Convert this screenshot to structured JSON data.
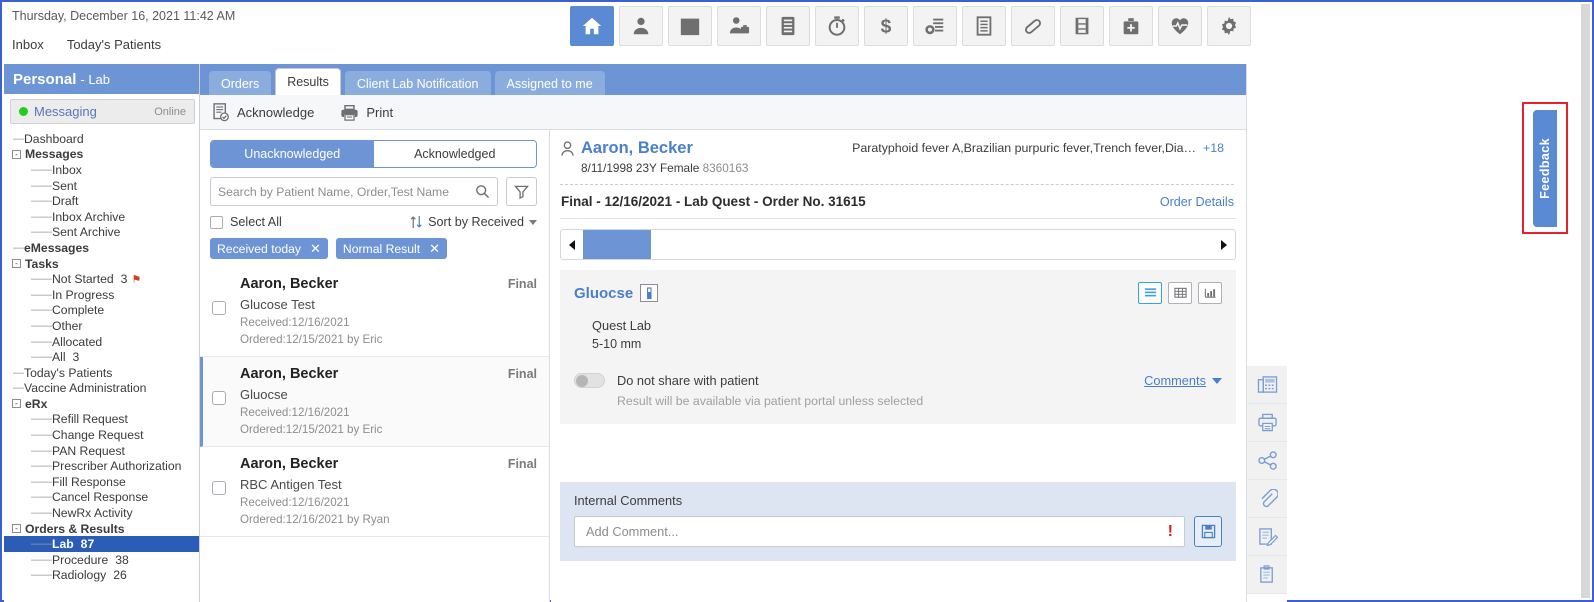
{
  "topbar": {
    "datetime": "Thursday, December 16, 2021  11:42 AM",
    "nav": [
      {
        "label": "Inbox"
      },
      {
        "label": "Today's Patients"
      }
    ],
    "icons": [
      {
        "name": "home-icon",
        "active": true
      },
      {
        "name": "patient-icon",
        "active": false
      },
      {
        "name": "calendar-icon",
        "active": false
      },
      {
        "name": "provider-icon",
        "active": false
      },
      {
        "name": "chart-file-icon",
        "active": false
      },
      {
        "name": "timer-icon",
        "active": false
      },
      {
        "name": "dollar-icon",
        "active": false
      },
      {
        "name": "billing-icon",
        "active": false
      },
      {
        "name": "document-icon",
        "active": false
      },
      {
        "name": "pill-icon",
        "active": false
      },
      {
        "name": "film-icon",
        "active": false
      },
      {
        "name": "medkit-icon",
        "active": false
      },
      {
        "name": "vitals-icon",
        "active": false
      },
      {
        "name": "settings-icon",
        "active": false
      }
    ]
  },
  "sidebar": {
    "title": "Personal",
    "subtitle": "- Lab",
    "messaging": {
      "label": "Messaging",
      "status": "Online"
    },
    "tree": [
      {
        "label": "Dashboard",
        "level": 0,
        "bold": false,
        "expander": ""
      },
      {
        "label": "Messages",
        "level": 0,
        "bold": true,
        "expander": "-"
      },
      {
        "label": "Inbox",
        "level": 1,
        "bold": false,
        "expander": ""
      },
      {
        "label": "Sent",
        "level": 1,
        "bold": false,
        "expander": ""
      },
      {
        "label": "Draft",
        "level": 1,
        "bold": false,
        "expander": ""
      },
      {
        "label": "Inbox Archive",
        "level": 1,
        "bold": false,
        "expander": ""
      },
      {
        "label": "Sent Archive",
        "level": 1,
        "bold": false,
        "expander": ""
      },
      {
        "label": "eMessages",
        "level": 0,
        "bold": true,
        "expander": ""
      },
      {
        "label": "Tasks",
        "level": 0,
        "bold": true,
        "expander": "-"
      },
      {
        "label": "Not Started",
        "level": 1,
        "bold": false,
        "expander": "",
        "count": "3",
        "alert": true
      },
      {
        "label": "In Progress",
        "level": 1,
        "bold": false,
        "expander": ""
      },
      {
        "label": "Complete",
        "level": 1,
        "bold": false,
        "expander": ""
      },
      {
        "label": "Other",
        "level": 1,
        "bold": false,
        "expander": ""
      },
      {
        "label": "Allocated",
        "level": 1,
        "bold": false,
        "expander": ""
      },
      {
        "label": "All",
        "level": 1,
        "bold": false,
        "expander": "",
        "count": "3"
      },
      {
        "label": "Today's Patients",
        "level": 0,
        "bold": false,
        "expander": ""
      },
      {
        "label": "Vaccine Administration",
        "level": 0,
        "bold": false,
        "expander": ""
      },
      {
        "label": "eRx",
        "level": 0,
        "bold": true,
        "expander": "-"
      },
      {
        "label": "Refill Request",
        "level": 1,
        "bold": false,
        "expander": ""
      },
      {
        "label": "Change Request",
        "level": 1,
        "bold": false,
        "expander": ""
      },
      {
        "label": "PAN Request",
        "level": 1,
        "bold": false,
        "expander": ""
      },
      {
        "label": "Prescriber Authorization",
        "level": 1,
        "bold": false,
        "expander": ""
      },
      {
        "label": "Fill Response",
        "level": 1,
        "bold": false,
        "expander": ""
      },
      {
        "label": "Cancel Response",
        "level": 1,
        "bold": false,
        "expander": ""
      },
      {
        "label": "NewRx Activity",
        "level": 1,
        "bold": false,
        "expander": ""
      },
      {
        "label": "Orders & Results",
        "level": 0,
        "bold": true,
        "expander": "-"
      },
      {
        "label": "Lab",
        "level": 1,
        "bold": false,
        "expander": "",
        "count": "87",
        "selected": true
      },
      {
        "label": "Procedure",
        "level": 1,
        "bold": false,
        "expander": "",
        "count": "38"
      },
      {
        "label": "Radiology",
        "level": 1,
        "bold": false,
        "expander": "",
        "count": "26"
      }
    ]
  },
  "tabs": [
    {
      "label": "Orders",
      "active": false
    },
    {
      "label": "Results",
      "active": true
    },
    {
      "label": "Client Lab Notification",
      "active": false
    },
    {
      "label": "Assigned to me",
      "active": false
    }
  ],
  "actionbar": [
    {
      "label": "Acknowledge",
      "icon": "acknowledge-icon"
    },
    {
      "label": "Print",
      "icon": "print-icon"
    }
  ],
  "list": {
    "segments": [
      {
        "label": "Unacknowledged",
        "active": true
      },
      {
        "label": "Acknowledged",
        "active": false
      }
    ],
    "search_placeholder": "Search by Patient Name, Order,Test Name",
    "search_value": "",
    "select_all_label": "Select All",
    "sort_label": "Sort by Received",
    "chips": [
      {
        "label": "Received today"
      },
      {
        "label": "Normal Result"
      }
    ],
    "items": [
      {
        "name": "Aaron, Becker",
        "status": "Final",
        "test": "Glucose Test",
        "received": "Received:12/16/2021",
        "ordered": "Ordered:12/15/2021 by  Eric",
        "selected": false
      },
      {
        "name": "Aaron, Becker",
        "status": "Final",
        "test": "Gluocse",
        "received": "Received:12/16/2021",
        "ordered": "Ordered:12/15/2021 by  Eric",
        "selected": true
      },
      {
        "name": "Aaron, Becker",
        "status": "Final",
        "test": "RBC Antigen Test",
        "received": "Received:12/16/2021",
        "ordered": "Ordered:12/16/2021 by  Ryan",
        "selected": false
      }
    ]
  },
  "detail": {
    "patient_name": "Aaron, Becker",
    "patient_demo": "8/11/1998 23Y Female ",
    "patient_mrn": "8360163",
    "diagnoses": "Paratyphoid fever A,Brazilian purpuric fever,Trench fever,Dia…",
    "diagnoses_more": "+18",
    "order_title": "Final - 12/16/2021 - Lab Quest - Order No. 31615",
    "order_details_link": "Order Details",
    "result": {
      "test_name": "Gluocse",
      "lab_name": "Quest Lab",
      "value": "5-10 mm",
      "view_modes": [
        {
          "name": "list-view-icon",
          "active": true
        },
        {
          "name": "table-view-icon",
          "active": false
        },
        {
          "name": "graph-view-icon",
          "active": false
        }
      ]
    },
    "share_toggle_label": "Do not share with patient",
    "share_note": "Result will be available via patient portal unless selected",
    "comments_link": "Comments",
    "internal_comments_label": "Internal Comments",
    "comment_placeholder": "Add Comment...",
    "comment_value": ""
  },
  "right_tools": [
    {
      "name": "fax-icon"
    },
    {
      "name": "print-icon"
    },
    {
      "name": "share-icon"
    },
    {
      "name": "attachment-icon"
    },
    {
      "name": "edit-note-icon"
    },
    {
      "name": "clipboard-icon"
    }
  ],
  "feedback": {
    "label": "Feedback"
  },
  "colors": {
    "accent_blue": "#6d94d4",
    "header_blue": "#5b8ad4",
    "link_blue": "#4a7fc9",
    "selected_tree": "#2a5cb8",
    "comments_bg": "#dde5f3",
    "highlight_red": "#e8212c",
    "alert_red": "#e02020",
    "online_green": "#22cc22"
  }
}
